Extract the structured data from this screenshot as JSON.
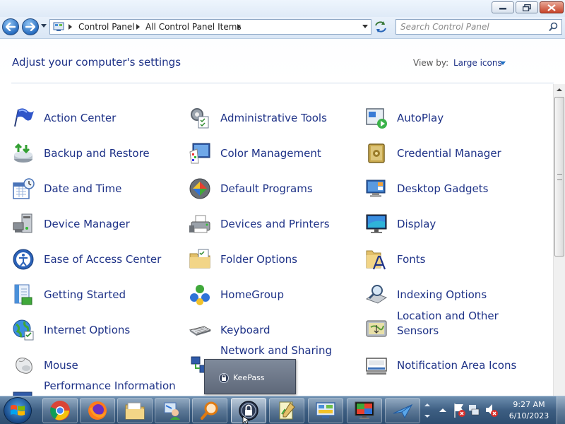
{
  "address": {
    "crumbs": [
      "Control Panel",
      "All Control Panel Items"
    ]
  },
  "search": {
    "placeholder": "Search Control Panel"
  },
  "header": {
    "title": "Adjust your computer's settings",
    "view_by_label": "View by:",
    "view_by_value": "Large icons"
  },
  "items": [
    {
      "label": "Action Center",
      "icon": "flag-icon"
    },
    {
      "label": "Administrative Tools",
      "icon": "tools-icon"
    },
    {
      "label": "AutoPlay",
      "icon": "autoplay-icon"
    },
    {
      "label": "Backup and Restore",
      "icon": "backup-icon"
    },
    {
      "label": "Color Management",
      "icon": "color-management-icon"
    },
    {
      "label": "Credential Manager",
      "icon": "credential-vault-icon"
    },
    {
      "label": "Date and Time",
      "icon": "calendar-clock-icon"
    },
    {
      "label": "Default Programs",
      "icon": "default-programs-icon"
    },
    {
      "label": "Desktop Gadgets",
      "icon": "gadgets-icon"
    },
    {
      "label": "Device Manager",
      "icon": "device-manager-icon"
    },
    {
      "label": "Devices and Printers",
      "icon": "printer-icon"
    },
    {
      "label": "Display",
      "icon": "monitor-icon"
    },
    {
      "label": "Ease of Access Center",
      "icon": "ease-of-access-icon"
    },
    {
      "label": "Folder Options",
      "icon": "folder-options-icon"
    },
    {
      "label": "Fonts",
      "icon": "fonts-folder-icon"
    },
    {
      "label": "Getting Started",
      "icon": "getting-started-icon"
    },
    {
      "label": "HomeGroup",
      "icon": "homegroup-icon"
    },
    {
      "label": "Indexing Options",
      "icon": "indexing-icon"
    },
    {
      "label": "Internet Options",
      "icon": "internet-options-icon"
    },
    {
      "label": "Keyboard",
      "icon": "keyboard-icon"
    },
    {
      "label": "Location and Other Sensors",
      "icon": "sensors-icon"
    },
    {
      "label": "Mouse",
      "icon": "mouse-icon"
    },
    {
      "label": "Network and Sharing",
      "icon": "network-icon"
    },
    {
      "label": "Notification Area Icons",
      "icon": "notification-icon"
    },
    {
      "label": "Performance Information",
      "icon": "performance-icon"
    }
  ],
  "tooltip": {
    "label": "KeePass"
  },
  "taskbar": {
    "apps": [
      "chrome-icon",
      "firefox-icon",
      "explorer-icon",
      "user-accounts-icon",
      "search-app-icon",
      "keepass-icon",
      "notepad-icon",
      "control-panel-icon",
      "display-app-icon",
      "vpn-icon"
    ]
  },
  "clock": {
    "time": "9:27 AM",
    "date": "6/10/2023"
  }
}
